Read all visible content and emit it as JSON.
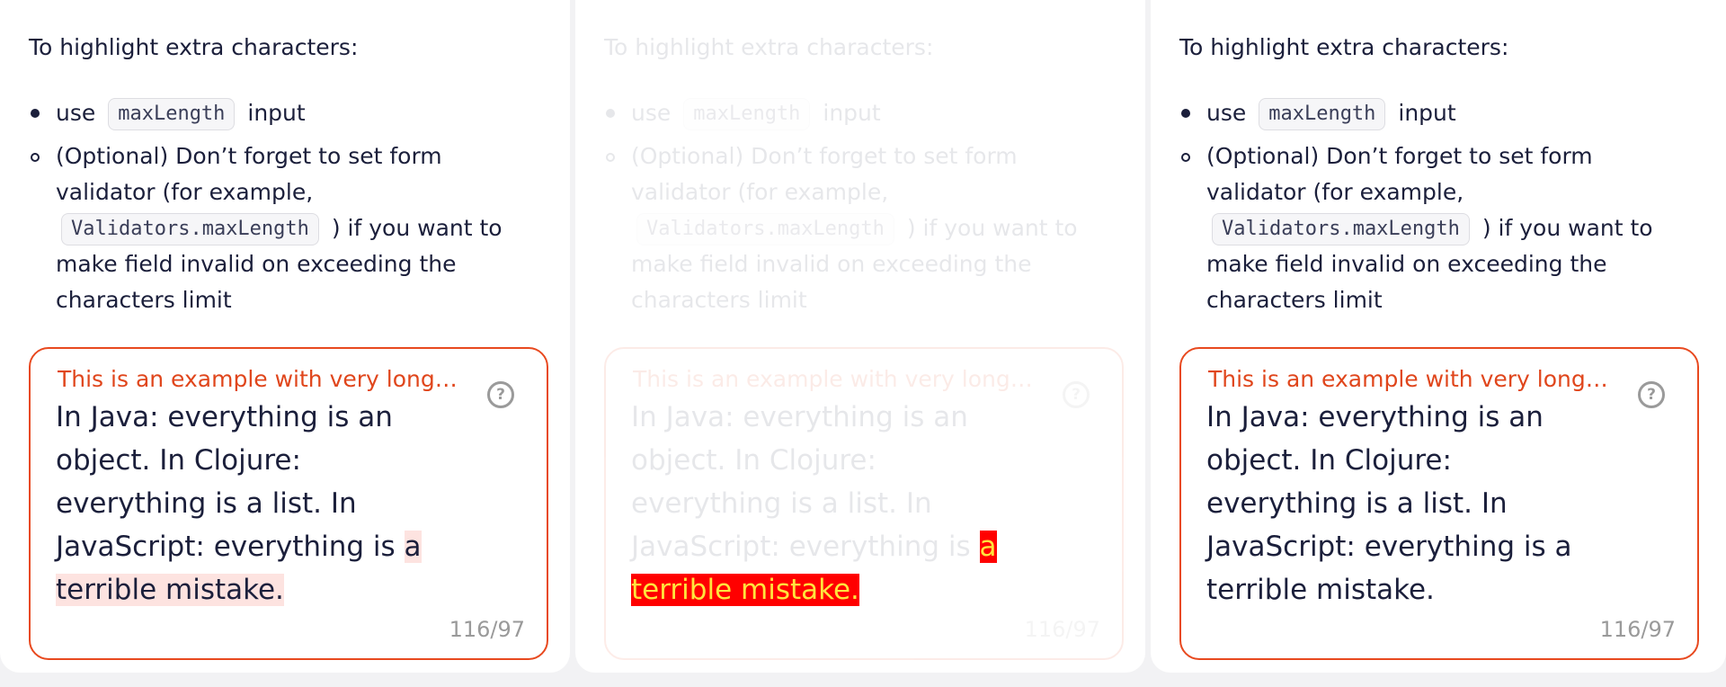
{
  "intro": "To highlight extra characters:",
  "list": {
    "item1_prefix": "use",
    "item1_code": "maxLength",
    "item1_suffix": "input",
    "item2_prefix": "(Optional) Don’t forget to set form validator (for example,",
    "item2_code": "Validators.maxLength",
    "item2_suffix": ") if you want to make field invalid on exceeding the characters limit"
  },
  "field": {
    "label": "This is an example with very long label",
    "help_icon": "question-circle-icon",
    "text_within": "In Java: everything is an object. In Clojure: everything is a list. In JavaScript: everything is",
    "text_over": "a terrible mistake.",
    "counter": "116/97"
  },
  "colors": {
    "error_border": "#e8491f",
    "soft_highlight": "#fde3e0",
    "strong_highlight": "#ff0000",
    "strong_highlight_text": "#ffe43d"
  }
}
